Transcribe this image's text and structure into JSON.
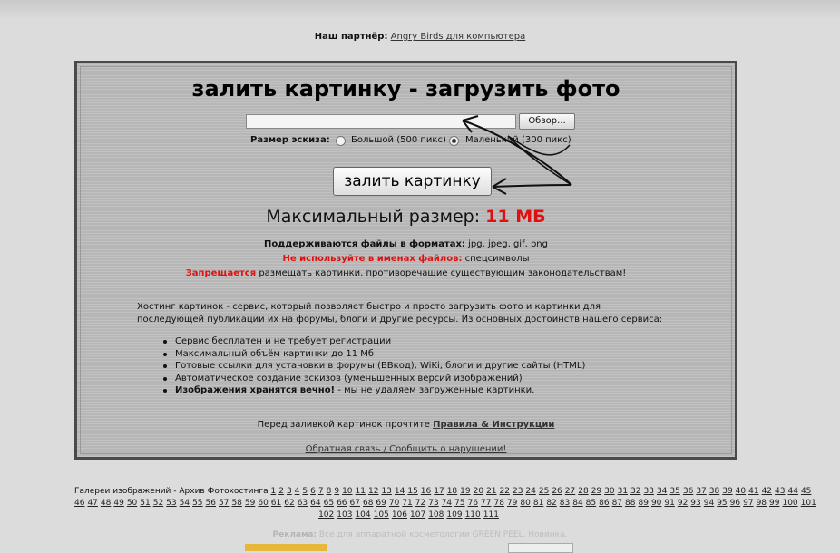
{
  "partner": {
    "label": "Наш партнёр:",
    "link": "Angry Birds для компьютера"
  },
  "upload": {
    "title": "залить картинку - загрузить фото",
    "file_value": "",
    "browse_label": "Обзор...",
    "thumb_label": "Размер эскиза:",
    "option_large": "Большой (500 пикс)",
    "option_small": "Маленький (300 пикс)",
    "selected_option": "small",
    "submit_label": "залить картинку",
    "max_label": "Максимальный размер:",
    "max_value": "11 МБ",
    "formats_label": "Поддерживаются файлы в форматах:",
    "formats_value": "jpg, jpeg, gif, png",
    "names_label": "Не используйте в именах файлов:",
    "names_value": "спецсимволы",
    "forbidden_label": "Запрещается",
    "forbidden_text": "размещать картинки, противоречащие существующим законодательствам!",
    "description": "Хостинг картинок - сервис, который позволяет быстро и просто загрузить фото и картинки для последующей публикации их на форумы, блоги и другие ресурсы. Из основных достоинств нашего сервиса:",
    "features": [
      "Сервис бесплатен и не требует регистрации",
      "Максимальный объём картинки до 11 Мб",
      "Готовые ссылки для установки в форумы (BBкод), WiKi, блоги и другие сайты (HTML)",
      "Автоматическое создание эскизов (уменьшенных версий изображений)"
    ],
    "feature_bold": "Изображения хранятся вечно!",
    "feature_bold_rest": "- мы не удаляем загруженные картинки.",
    "rules_prefix": "Перед заливкой картинок прочтите",
    "rules_link": "Правила & Инструкции",
    "feedback_link": "Обратная связь / Сообщить о нарушении!"
  },
  "gallery": {
    "label": "Галереи изображений - Архив Фотохостинга",
    "pages": [
      "1",
      "2",
      "3",
      "4",
      "5",
      "6",
      "7",
      "8",
      "9",
      "10",
      "11",
      "12",
      "13",
      "14",
      "15",
      "16",
      "17",
      "18",
      "19",
      "20",
      "21",
      "22",
      "23",
      "24",
      "25",
      "26",
      "27",
      "28",
      "29",
      "30",
      "31",
      "32",
      "33",
      "34",
      "35",
      "36",
      "37",
      "38",
      "39",
      "40",
      "41",
      "42",
      "43",
      "44",
      "45",
      "46",
      "47",
      "48",
      "49",
      "50",
      "51",
      "52",
      "53",
      "54",
      "55",
      "56",
      "57",
      "58",
      "59",
      "60",
      "61",
      "62",
      "63",
      "64",
      "65",
      "66",
      "67",
      "68",
      "69",
      "70",
      "71",
      "72",
      "73",
      "74",
      "75",
      "76",
      "77",
      "78",
      "79",
      "80",
      "81",
      "82",
      "83",
      "84",
      "85",
      "86",
      "87",
      "88",
      "89",
      "90",
      "91",
      "92",
      "93",
      "94",
      "95",
      "96",
      "97",
      "98",
      "99",
      "100",
      "101",
      "102",
      "103",
      "104",
      "105",
      "106",
      "107",
      "108",
      "109",
      "110",
      "111"
    ]
  },
  "ad": {
    "label": "Реклама:",
    "text": "Все для аппаратной косметологии",
    "brand": "GREEN PEEL. Новинка."
  },
  "colors": {
    "accent_red": "#e01010",
    "panel_bg": "#bdbdbd"
  }
}
